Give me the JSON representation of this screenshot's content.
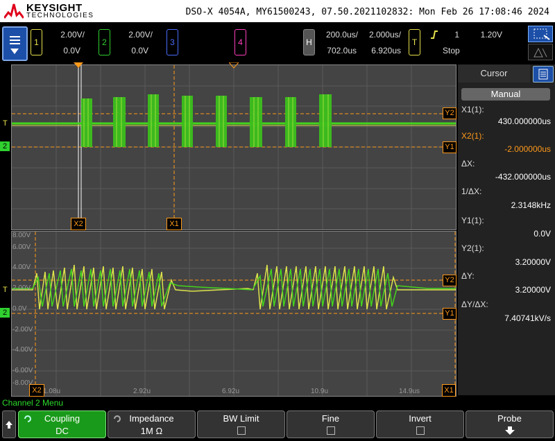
{
  "header": {
    "brand": "KEYSIGHT",
    "brand_sub": "TECHNOLOGIES",
    "info": "DSO-X 4054A, MY61500243, 07.50.2021102832: Mon Feb 26 17:08:46 2024"
  },
  "channels": [
    {
      "num": "1",
      "scale": "2.00V/",
      "offset": "0.0V",
      "color": "#e9e24a"
    },
    {
      "num": "2",
      "scale": "2.00V/",
      "offset": "0.0V",
      "color": "#30d030"
    },
    {
      "num": "3",
      "color": "#4a6cff"
    },
    {
      "num": "4",
      "color": "#ff3fbf"
    }
  ],
  "horizontal": {
    "label": "H",
    "scale": "200.0us/",
    "delay": "702.0us",
    "zoom_scale": "2.000us/",
    "zoom_delay": "6.920us"
  },
  "trigger": {
    "label": "T",
    "channel": "1",
    "level": "1.20V",
    "state": "Stop"
  },
  "cursor_panel": {
    "title": "Cursor",
    "mode_button": "Manual",
    "x1_label": "X1(1):",
    "x1_value": "430.000000us",
    "x2_label": "X2(1):",
    "x2_value": "-2.000000us",
    "dx_label": "ΔX:",
    "dx_value": "-432.000000us",
    "inv_dx_label": "1/ΔX:",
    "inv_dx_value": "2.3148kHz",
    "y1_label": "Y1(1):",
    "y1_value": "0.0V",
    "y2_label": "Y2(1):",
    "y2_value": "3.20000V",
    "dy_label": "ΔY:",
    "dy_value": "3.20000V",
    "dydx_label": "ΔY/ΔX:",
    "dydx_value": "7.40741kV/s"
  },
  "markers": {
    "x1": "X1",
    "x2": "X2",
    "y1": "Y1",
    "y2": "Y2",
    "trig": "T"
  },
  "bottom_grid": {
    "y_labels": [
      "8.00V",
      "6.00V",
      "4.00V",
      "2.00V",
      "0.0V",
      "-2.00V",
      "-4.00V",
      "-6.00V",
      "-8.00V"
    ],
    "x_labels": [
      "1.08u",
      "2.92u",
      "6.92u",
      "10.9u",
      "14.9us"
    ]
  },
  "channel_menu": "Channel 2 Menu",
  "softkeys": [
    {
      "label": "Coupling",
      "value": "DC"
    },
    {
      "label": "Impedance",
      "value": "1M Ω"
    },
    {
      "label": "BW Limit"
    },
    {
      "label": "Fine"
    },
    {
      "label": "Invert"
    },
    {
      "label": "Probe"
    }
  ]
}
